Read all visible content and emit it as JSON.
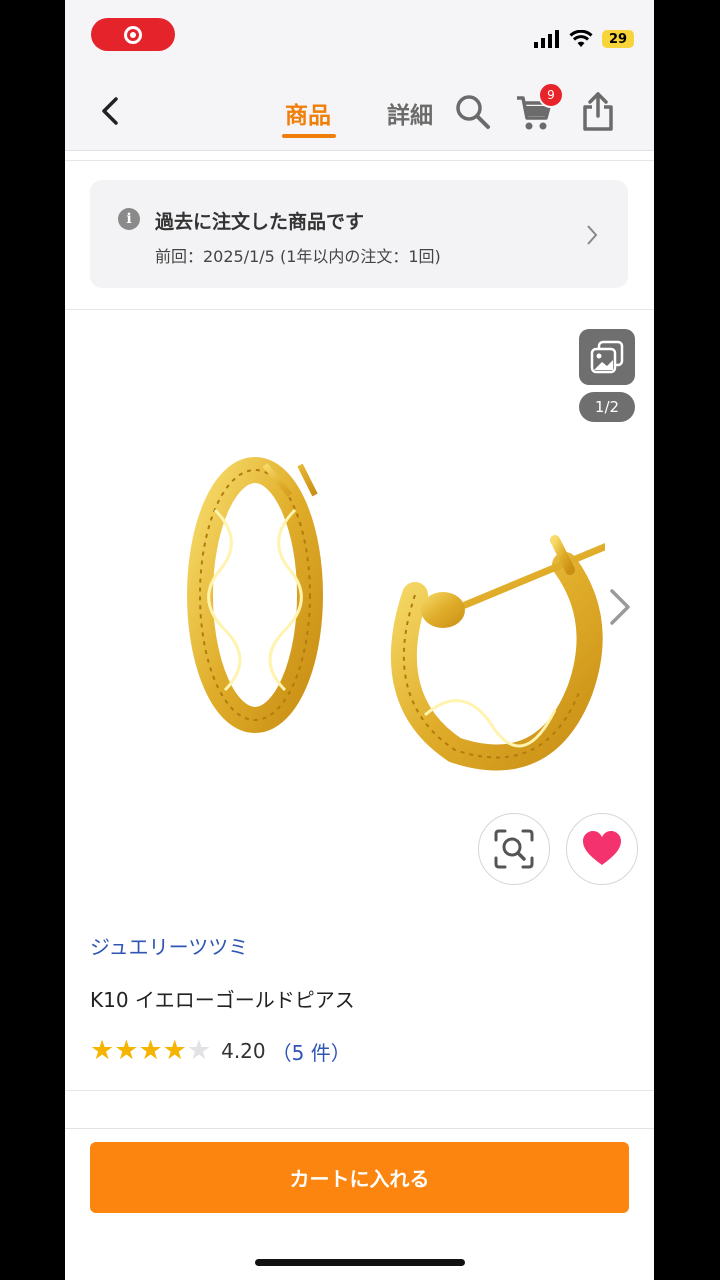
{
  "status_bar": {
    "battery": "29"
  },
  "nav": {
    "tab_product": "商品",
    "tab_detail": "詳細",
    "cart_count": "9",
    "accent_color": "#f07f0a"
  },
  "order_notice": {
    "title": "過去に注文した商品です",
    "subtitle": "前回：2025/1/5 (1年以内の注文：1回)"
  },
  "gallery": {
    "page_indicator": "1/2",
    "image_description": "gold filigree hoop earrings"
  },
  "product": {
    "shop_name": "ジュエリーツツミ",
    "title": "K10 イエローゴールドピアス",
    "rating_value": "4.20",
    "rating_stars": 4.2,
    "review_count": "（5 件）"
  },
  "cart_button": {
    "label": "カートに入れる",
    "color": "#fb850f"
  }
}
